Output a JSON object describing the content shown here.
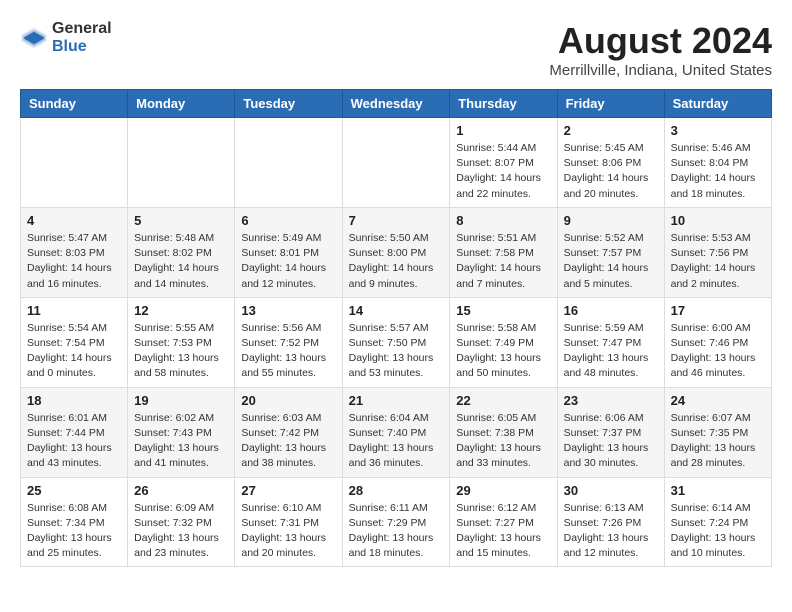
{
  "logo": {
    "general": "General",
    "blue": "Blue"
  },
  "title": "August 2024",
  "subtitle": "Merrillville, Indiana, United States",
  "days_of_week": [
    "Sunday",
    "Monday",
    "Tuesday",
    "Wednesday",
    "Thursday",
    "Friday",
    "Saturday"
  ],
  "weeks": [
    [
      {
        "day": "",
        "info": ""
      },
      {
        "day": "",
        "info": ""
      },
      {
        "day": "",
        "info": ""
      },
      {
        "day": "",
        "info": ""
      },
      {
        "day": "1",
        "info": "Sunrise: 5:44 AM\nSunset: 8:07 PM\nDaylight: 14 hours\nand 22 minutes."
      },
      {
        "day": "2",
        "info": "Sunrise: 5:45 AM\nSunset: 8:06 PM\nDaylight: 14 hours\nand 20 minutes."
      },
      {
        "day": "3",
        "info": "Sunrise: 5:46 AM\nSunset: 8:04 PM\nDaylight: 14 hours\nand 18 minutes."
      }
    ],
    [
      {
        "day": "4",
        "info": "Sunrise: 5:47 AM\nSunset: 8:03 PM\nDaylight: 14 hours\nand 16 minutes."
      },
      {
        "day": "5",
        "info": "Sunrise: 5:48 AM\nSunset: 8:02 PM\nDaylight: 14 hours\nand 14 minutes."
      },
      {
        "day": "6",
        "info": "Sunrise: 5:49 AM\nSunset: 8:01 PM\nDaylight: 14 hours\nand 12 minutes."
      },
      {
        "day": "7",
        "info": "Sunrise: 5:50 AM\nSunset: 8:00 PM\nDaylight: 14 hours\nand 9 minutes."
      },
      {
        "day": "8",
        "info": "Sunrise: 5:51 AM\nSunset: 7:58 PM\nDaylight: 14 hours\nand 7 minutes."
      },
      {
        "day": "9",
        "info": "Sunrise: 5:52 AM\nSunset: 7:57 PM\nDaylight: 14 hours\nand 5 minutes."
      },
      {
        "day": "10",
        "info": "Sunrise: 5:53 AM\nSunset: 7:56 PM\nDaylight: 14 hours\nand 2 minutes."
      }
    ],
    [
      {
        "day": "11",
        "info": "Sunrise: 5:54 AM\nSunset: 7:54 PM\nDaylight: 14 hours\nand 0 minutes."
      },
      {
        "day": "12",
        "info": "Sunrise: 5:55 AM\nSunset: 7:53 PM\nDaylight: 13 hours\nand 58 minutes."
      },
      {
        "day": "13",
        "info": "Sunrise: 5:56 AM\nSunset: 7:52 PM\nDaylight: 13 hours\nand 55 minutes."
      },
      {
        "day": "14",
        "info": "Sunrise: 5:57 AM\nSunset: 7:50 PM\nDaylight: 13 hours\nand 53 minutes."
      },
      {
        "day": "15",
        "info": "Sunrise: 5:58 AM\nSunset: 7:49 PM\nDaylight: 13 hours\nand 50 minutes."
      },
      {
        "day": "16",
        "info": "Sunrise: 5:59 AM\nSunset: 7:47 PM\nDaylight: 13 hours\nand 48 minutes."
      },
      {
        "day": "17",
        "info": "Sunrise: 6:00 AM\nSunset: 7:46 PM\nDaylight: 13 hours\nand 46 minutes."
      }
    ],
    [
      {
        "day": "18",
        "info": "Sunrise: 6:01 AM\nSunset: 7:44 PM\nDaylight: 13 hours\nand 43 minutes."
      },
      {
        "day": "19",
        "info": "Sunrise: 6:02 AM\nSunset: 7:43 PM\nDaylight: 13 hours\nand 41 minutes."
      },
      {
        "day": "20",
        "info": "Sunrise: 6:03 AM\nSunset: 7:42 PM\nDaylight: 13 hours\nand 38 minutes."
      },
      {
        "day": "21",
        "info": "Sunrise: 6:04 AM\nSunset: 7:40 PM\nDaylight: 13 hours\nand 36 minutes."
      },
      {
        "day": "22",
        "info": "Sunrise: 6:05 AM\nSunset: 7:38 PM\nDaylight: 13 hours\nand 33 minutes."
      },
      {
        "day": "23",
        "info": "Sunrise: 6:06 AM\nSunset: 7:37 PM\nDaylight: 13 hours\nand 30 minutes."
      },
      {
        "day": "24",
        "info": "Sunrise: 6:07 AM\nSunset: 7:35 PM\nDaylight: 13 hours\nand 28 minutes."
      }
    ],
    [
      {
        "day": "25",
        "info": "Sunrise: 6:08 AM\nSunset: 7:34 PM\nDaylight: 13 hours\nand 25 minutes."
      },
      {
        "day": "26",
        "info": "Sunrise: 6:09 AM\nSunset: 7:32 PM\nDaylight: 13 hours\nand 23 minutes."
      },
      {
        "day": "27",
        "info": "Sunrise: 6:10 AM\nSunset: 7:31 PM\nDaylight: 13 hours\nand 20 minutes."
      },
      {
        "day": "28",
        "info": "Sunrise: 6:11 AM\nSunset: 7:29 PM\nDaylight: 13 hours\nand 18 minutes."
      },
      {
        "day": "29",
        "info": "Sunrise: 6:12 AM\nSunset: 7:27 PM\nDaylight: 13 hours\nand 15 minutes."
      },
      {
        "day": "30",
        "info": "Sunrise: 6:13 AM\nSunset: 7:26 PM\nDaylight: 13 hours\nand 12 minutes."
      },
      {
        "day": "31",
        "info": "Sunrise: 6:14 AM\nSunset: 7:24 PM\nDaylight: 13 hours\nand 10 minutes."
      }
    ]
  ]
}
